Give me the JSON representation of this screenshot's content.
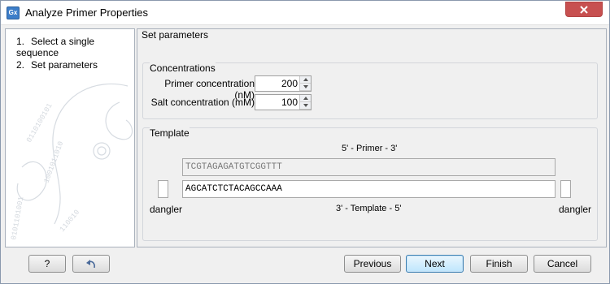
{
  "window": {
    "app_icon_text": "Gx",
    "title": "Analyze Primer Properties"
  },
  "steps": [
    {
      "num": "1.",
      "label": "Select a single sequence"
    },
    {
      "num": "2.",
      "label": "Set parameters"
    }
  ],
  "panel": {
    "header": "Set parameters",
    "concentrations": {
      "title": "Concentrations",
      "primer_label": "Primer concentration (nM)",
      "primer_value": "200",
      "salt_label": "Salt concentration (mM)",
      "salt_value": "100"
    },
    "template": {
      "title": "Template",
      "primer_caption": "5' - Primer - 3'",
      "primer_sequence": "TCGTAGAGATGTCGGTTT",
      "template_sequence": "AGCATCTCTACAGCCAAA",
      "template_caption": "3' - Template - 5'",
      "dangler_left": "dangler",
      "dangler_right": "dangler"
    }
  },
  "buttons": {
    "help": "?",
    "previous": "Previous",
    "next": "Next",
    "finish": "Finish",
    "cancel": "Cancel"
  },
  "icons": {
    "app": "gx-app-icon",
    "close": "close-icon",
    "reset": "undo-arrow-icon"
  },
  "colors": {
    "close_button": "#c75050",
    "default_button_border": "#3c7fb1",
    "app_icon": "#3d7ec9"
  }
}
